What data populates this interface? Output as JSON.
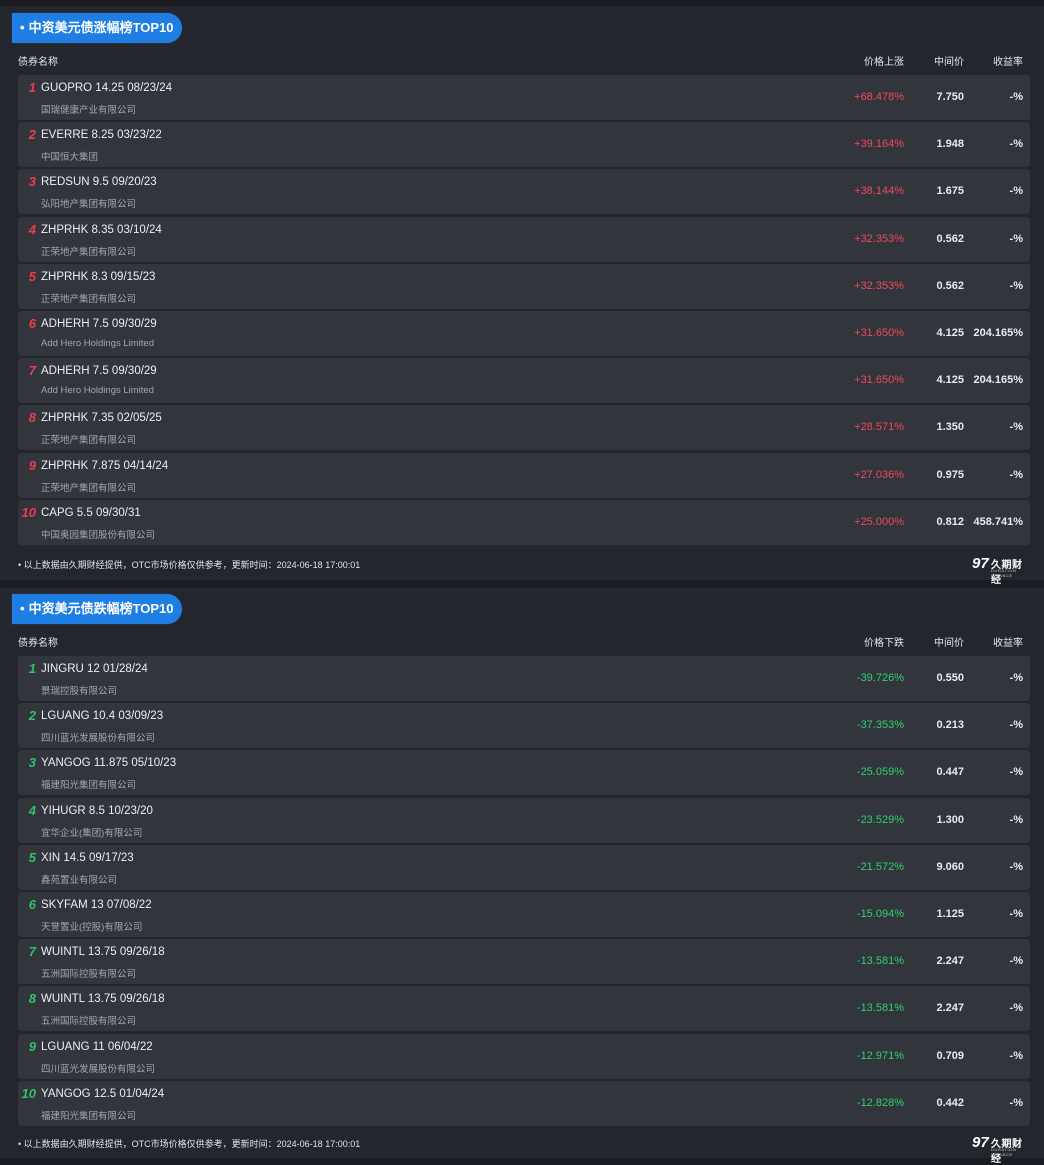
{
  "gainers": {
    "title": "中资美元债涨幅榜TOP10",
    "headers": {
      "name": "债券名称",
      "change": "价格上涨",
      "mid": "中间价",
      "yield": "收益率"
    },
    "rows": [
      {
        "rank": "1",
        "bond": "GUOPRO 14.25 08/23/24",
        "issuer": "国瑞健康产业有限公司",
        "change": "+68.478%",
        "mid": "7.750",
        "yield": "-%"
      },
      {
        "rank": "2",
        "bond": "EVERRE 8.25 03/23/22",
        "issuer": "中国恒大集团",
        "change": "+39.164%",
        "mid": "1.948",
        "yield": "-%"
      },
      {
        "rank": "3",
        "bond": "REDSUN 9.5 09/20/23",
        "issuer": "弘阳地产集团有限公司",
        "change": "+38.144%",
        "mid": "1.675",
        "yield": "-%"
      },
      {
        "rank": "4",
        "bond": "ZHPRHK 8.35 03/10/24",
        "issuer": "正荣地产集团有限公司",
        "change": "+32.353%",
        "mid": "0.562",
        "yield": "-%"
      },
      {
        "rank": "5",
        "bond": "ZHPRHK 8.3 09/15/23",
        "issuer": "正荣地产集团有限公司",
        "change": "+32.353%",
        "mid": "0.562",
        "yield": "-%"
      },
      {
        "rank": "6",
        "bond": "ADHERH 7.5 09/30/29",
        "issuer": "Add Hero Holdings Limited",
        "change": "+31.650%",
        "mid": "4.125",
        "yield": "204.165%"
      },
      {
        "rank": "7",
        "bond": "ADHERH 7.5 09/30/29",
        "issuer": "Add Hero Holdings Limited",
        "change": "+31.650%",
        "mid": "4.125",
        "yield": "204.165%"
      },
      {
        "rank": "8",
        "bond": "ZHPRHK 7.35 02/05/25",
        "issuer": "正荣地产集团有限公司",
        "change": "+28.571%",
        "mid": "1.350",
        "yield": "-%"
      },
      {
        "rank": "9",
        "bond": "ZHPRHK 7.875 04/14/24",
        "issuer": "正荣地产集团有限公司",
        "change": "+27.036%",
        "mid": "0.975",
        "yield": "-%"
      },
      {
        "rank": "10",
        "bond": "CAPG 5.5 09/30/31",
        "issuer": "中国奥园集团股份有限公司",
        "change": "+25.000%",
        "mid": "0.812",
        "yield": "458.741%"
      }
    ],
    "footer": "以上数据由久期财经提供，OTC市场价格仅供参考，更新时间：2024-06-18 17:00:01"
  },
  "losers": {
    "title": "中资美元债跌幅榜TOP10",
    "headers": {
      "name": "债券名称",
      "change": "价格下跌",
      "mid": "中间价",
      "yield": "收益率"
    },
    "rows": [
      {
        "rank": "1",
        "bond": "JINGRU 12 01/28/24",
        "issuer": "景瑞控股有限公司",
        "change": "-39.726%",
        "mid": "0.550",
        "yield": "-%"
      },
      {
        "rank": "2",
        "bond": "LGUANG 10.4 03/09/23",
        "issuer": "四川蓝光发展股份有限公司",
        "change": "-37.353%",
        "mid": "0.213",
        "yield": "-%"
      },
      {
        "rank": "3",
        "bond": "YANGOG 11.875 05/10/23",
        "issuer": "福建阳光集团有限公司",
        "change": "-25.059%",
        "mid": "0.447",
        "yield": "-%"
      },
      {
        "rank": "4",
        "bond": "YIHUGR 8.5 10/23/20",
        "issuer": "宜华企业(集团)有限公司",
        "change": "-23.529%",
        "mid": "1.300",
        "yield": "-%"
      },
      {
        "rank": "5",
        "bond": "XIN 14.5 09/17/23",
        "issuer": "鑫苑置业有限公司",
        "change": "-21.572%",
        "mid": "9.060",
        "yield": "-%"
      },
      {
        "rank": "6",
        "bond": "SKYFAM 13 07/08/22",
        "issuer": "天誉置业(控股)有限公司",
        "change": "-15.094%",
        "mid": "1.125",
        "yield": "-%"
      },
      {
        "rank": "7",
        "bond": "WUINTL 13.75 09/26/18",
        "issuer": "五洲国际控股有限公司",
        "change": "-13.581%",
        "mid": "2.247",
        "yield": "-%"
      },
      {
        "rank": "8",
        "bond": "WUINTL 13.75 09/26/18",
        "issuer": "五洲国际控股有限公司",
        "change": "-13.581%",
        "mid": "2.247",
        "yield": "-%"
      },
      {
        "rank": "9",
        "bond": "LGUANG 11 06/04/22",
        "issuer": "四川蓝光发展股份有限公司",
        "change": "-12.971%",
        "mid": "0.709",
        "yield": "-%"
      },
      {
        "rank": "10",
        "bond": "YANGOG 12.5 01/04/24",
        "issuer": "福建阳光集团有限公司",
        "change": "-12.828%",
        "mid": "0.442",
        "yield": "-%"
      }
    ],
    "footer": "以上数据由久期财经提供，OTC市场价格仅供参考，更新时间：2024-06-18 17:00:01"
  },
  "logo": {
    "mark": "97",
    "brand": "久期财经",
    "sub": "DURATION FINANCE"
  },
  "colors": {
    "accent": "#1e7ee4",
    "up": "#f0485c",
    "down": "#2fd070",
    "background": "#23262d",
    "row": "#32353c"
  }
}
